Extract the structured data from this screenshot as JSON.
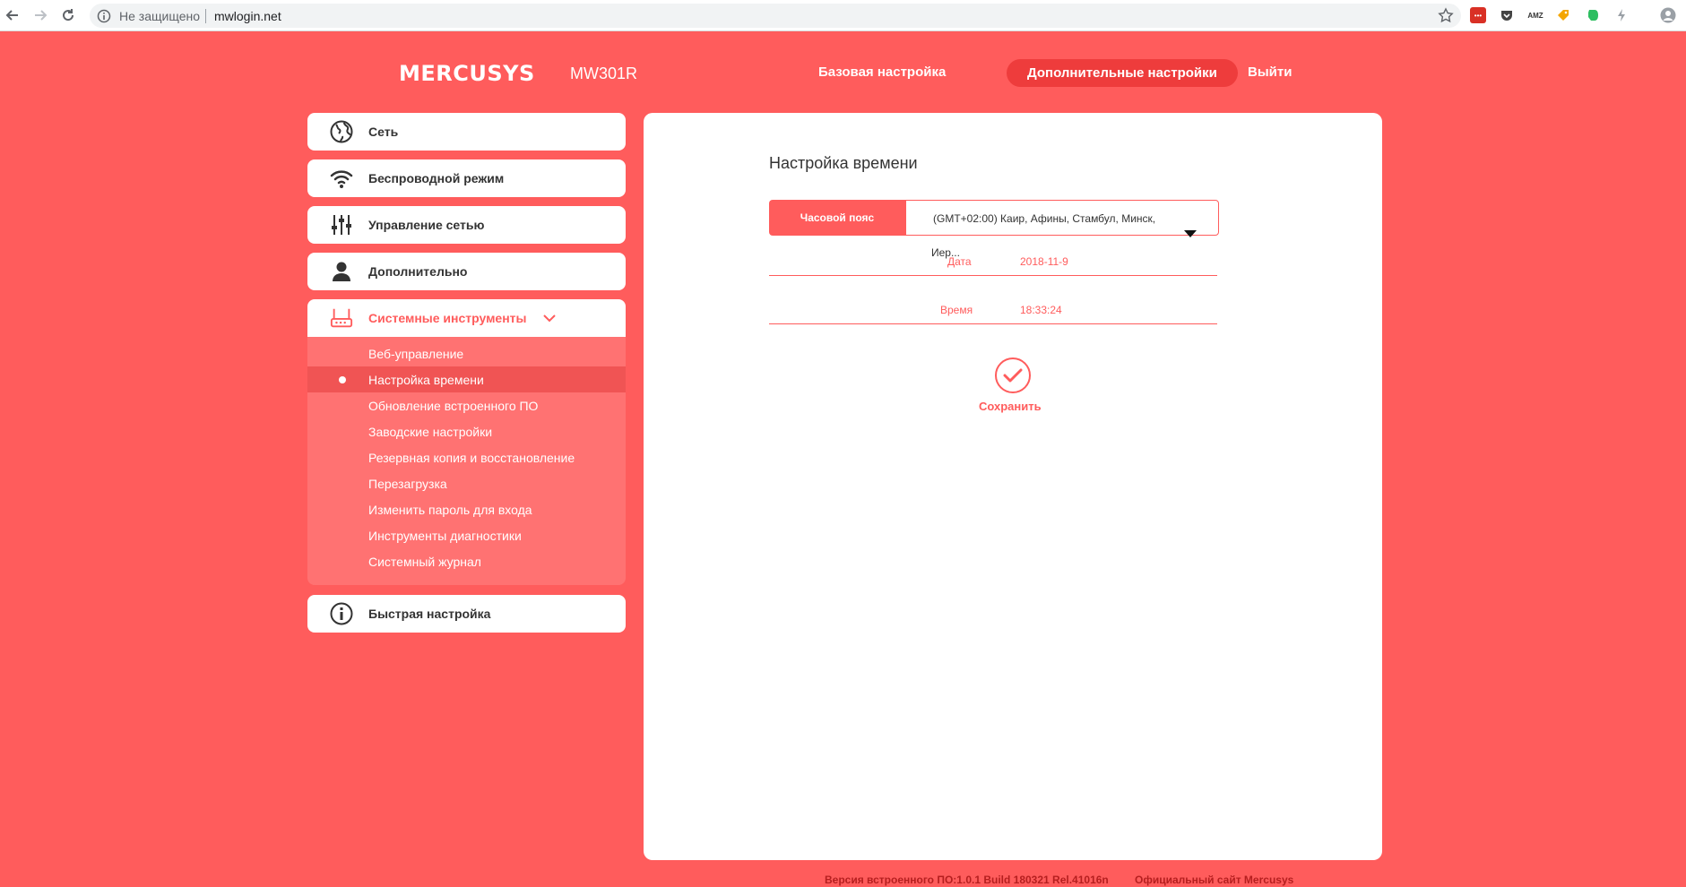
{
  "browser": {
    "security_text": "Не защищено",
    "url": "mwlogin.net"
  },
  "header": {
    "logo": "MERCUSYS",
    "model": "MW301R",
    "nav": [
      {
        "label": "Базовая настройка",
        "active": false
      },
      {
        "label": "Дополнительные настройки",
        "active": true
      },
      {
        "label": "Выйти",
        "active": false
      }
    ]
  },
  "sidebar": {
    "items": [
      {
        "label": "Сеть",
        "icon": "globe-icon"
      },
      {
        "label": "Беспроводной режим",
        "icon": "wifi-icon"
      },
      {
        "label": "Управление сетью",
        "icon": "sliders-icon"
      },
      {
        "label": "Дополнительно",
        "icon": "user-icon"
      },
      {
        "label": "Системные инструменты",
        "icon": "router-icon",
        "expanded": true
      },
      {
        "label": "Быстрая настройка",
        "icon": "info-icon"
      }
    ],
    "system_tools": [
      "Веб-управление",
      "Настройка времени",
      "Обновление встроенного ПО",
      "Заводские настройки",
      "Резервная копия и восстановление",
      "Перезагрузка",
      "Изменить пароль для входа",
      "Инструменты диагностики",
      "Системный журнал"
    ],
    "active_sub": "Настройка времени"
  },
  "content": {
    "title": "Настройка времени",
    "timezone_label": "Часовой пояс",
    "timezone_value": "(GMT+02:00) Каир, Афины, Стамбул, Минск,",
    "timezone_overflow": "Иер...",
    "date_label": "Дата",
    "date_value": "2018-11-9",
    "time_label": "Время",
    "time_value": "18:33:24",
    "save_label": "Сохранить"
  },
  "footer": {
    "firmware": "Версия встроенного ПО:1.0.1 Build 180321 Rel.41016n",
    "site": "Официальный сайт Mercusys"
  },
  "colors": {
    "accent": "#ff5c5c",
    "accent_dark": "#ee3c3c",
    "submenu_bg": "#ff7272",
    "footer_text": "#b51f1f"
  }
}
